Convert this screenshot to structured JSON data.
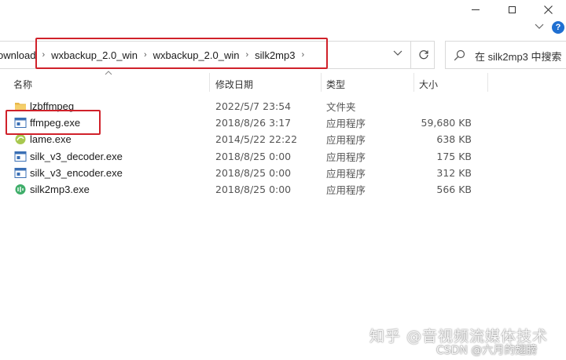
{
  "window": {
    "minimize": "minimize",
    "maximize": "maximize",
    "close": "close"
  },
  "ribbon": {
    "help_label": "?"
  },
  "address": {
    "crumbs": [
      "ownload",
      "wxbackup_2.0_win",
      "wxbackup_2.0_win",
      "silk2mp3"
    ]
  },
  "search": {
    "placeholder": "在 silk2mp3 中搜索"
  },
  "columns": {
    "name": "名称",
    "date": "修改日期",
    "type": "类型",
    "size": "大小"
  },
  "files": [
    {
      "name": "lzbffmpeg",
      "date": "2022/5/7 23:54",
      "type": "文件夹",
      "size": "",
      "icon": "folder-icon"
    },
    {
      "name": "ffmpeg.exe",
      "date": "2018/8/26 3:17",
      "type": "应用程序",
      "size": "59,680 KB",
      "icon": "exe-window-icon"
    },
    {
      "name": "lame.exe",
      "date": "2014/5/22 22:22",
      "type": "应用程序",
      "size": "638 KB",
      "icon": "lame-app-icon"
    },
    {
      "name": "silk_v3_decoder.exe",
      "date": "2018/8/25 0:00",
      "type": "应用程序",
      "size": "175 KB",
      "icon": "exe-window-icon"
    },
    {
      "name": "silk_v3_encoder.exe",
      "date": "2018/8/25 0:00",
      "type": "应用程序",
      "size": "312 KB",
      "icon": "exe-window-icon"
    },
    {
      "name": "silk2mp3.exe",
      "date": "2018/8/25 0:00",
      "type": "应用程序",
      "size": "566 KB",
      "icon": "silk2mp3-app-icon"
    }
  ],
  "watermark": {
    "line1": "知乎 @音视频流媒体技术",
    "line2": "CSDN @六月的翅膀"
  },
  "colors": {
    "highlight": "#d0212a",
    "folder": "#e8b84a",
    "accent": "#1f6fd1"
  }
}
